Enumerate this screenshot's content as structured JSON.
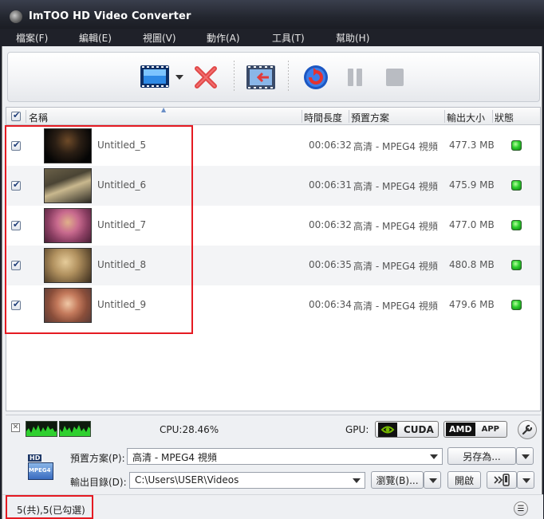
{
  "window": {
    "title": "ImTOO HD Video Converter"
  },
  "menu": [
    {
      "label": "檔案(F)"
    },
    {
      "label": "編輯(E)"
    },
    {
      "label": "視圖(V)"
    },
    {
      "label": "動作(A)"
    },
    {
      "label": "工具(T)"
    },
    {
      "label": "幫助(H)"
    }
  ],
  "toolbar": {
    "add_icon": "film-add-icon",
    "delete_icon": "red-x-icon",
    "clip_icon": "film-clip-icon",
    "convert_icon": "convert-icon",
    "pause_icon": "pause-icon",
    "stop_icon": "stop-icon"
  },
  "list": {
    "columns": {
      "name": "名稱",
      "duration": "時間長度",
      "preset": "預置方案",
      "size": "輸出大小",
      "status": "狀態"
    },
    "rows": [
      {
        "name": "Untitled_5",
        "duration": "00:06:32",
        "preset": "高清 - MPEG4 視頻",
        "size": "477.3 MB",
        "thumb": "#2a1e14"
      },
      {
        "name": "Untitled_6",
        "duration": "00:06:31",
        "preset": "高清 - MPEG4 視頻",
        "size": "475.9 MB",
        "thumb": "#4a4434"
      },
      {
        "name": "Untitled_7",
        "duration": "00:06:32",
        "preset": "高清 - MPEG4 視頻",
        "size": "477.0 MB",
        "thumb": "#8a3e62"
      },
      {
        "name": "Untitled_8",
        "duration": "00:06:35",
        "preset": "高清 - MPEG4 視頻",
        "size": "480.8 MB",
        "thumb": "#9a7a4c"
      },
      {
        "name": "Untitled_9",
        "duration": "00:06:34",
        "preset": "高清 - MPEG4 視頻",
        "size": "479.6 MB",
        "thumb": "#8a4e3a"
      }
    ]
  },
  "cpu": {
    "label": "CPU:28.46%",
    "gpu_label": "GPU:",
    "cuda": "CUDA",
    "amd": "AMD",
    "app": "APP"
  },
  "settings": {
    "preset_label": "預置方案(P):",
    "preset_value": "高清 - MPEG4 視頻",
    "save_as": "另存為...",
    "output_label": "輸出目錄(D):",
    "output_value": "C:\\Users\\USER\\Videos",
    "browse": "瀏覽(B)...",
    "open": "開啟",
    "device_icon": "device-transfer-icon",
    "format_badge": "MPEG4"
  },
  "status": {
    "text": "5(共),5(已勾選)"
  },
  "colors": {
    "highlight": "#e51a22",
    "status_ok": "#2fd02f"
  }
}
